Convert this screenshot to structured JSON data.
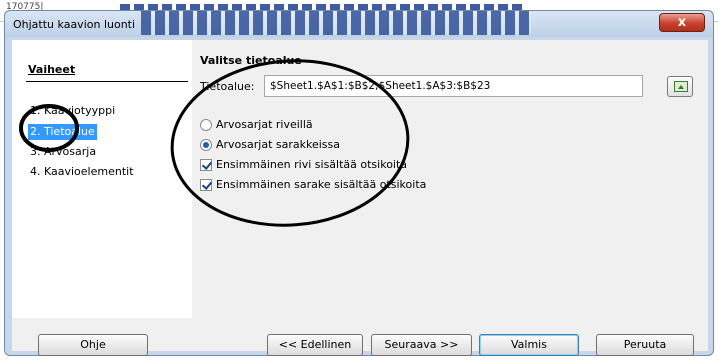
{
  "background": {
    "cell_ref": "170775|"
  },
  "window": {
    "title": "Ohjattu kaavion luonti",
    "close_label": "x"
  },
  "sidebar": {
    "header": "Vaiheet",
    "items": [
      {
        "label": "1. Kaaviotyyppi"
      },
      {
        "label": "2. Tietoalue"
      },
      {
        "label": "3. Arvosarja"
      },
      {
        "label": "4. Kaavioelementit"
      }
    ]
  },
  "main": {
    "section_title": "Valitse tietoalue",
    "range_label": "Tietoalue:",
    "range_value": "$Sheet1.$A$1:$B$2;$Sheet1.$A$3:$B$23",
    "options": {
      "rows": "Arvosarjat riveillä",
      "columns": "Arvosarjat sarakkeissa",
      "first_row": "Ensimmäinen rivi sisältää otsikoita",
      "first_col": "Ensimmäinen sarake sisältää otsikoita"
    }
  },
  "buttons": {
    "help": "Ohje",
    "prev": "<< Edellinen",
    "next": "Seuraava >>",
    "finish": "Valmis",
    "cancel": "Peruuta"
  },
  "colors": {
    "selection": "#3399ff",
    "annotation": "#000000",
    "title_bg": "#c6d7ea"
  }
}
